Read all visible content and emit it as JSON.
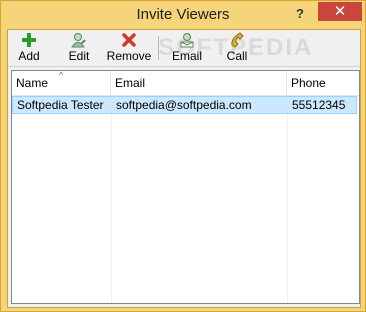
{
  "window": {
    "title": "Invite Viewers",
    "help": "?",
    "close": "✕"
  },
  "toolbar": {
    "add": "Add",
    "edit": "Edit",
    "remove": "Remove",
    "email": "Email",
    "call": "Call",
    "watermark": "SOFTPEDIA"
  },
  "columns": [
    "Name",
    "Email",
    "Phone"
  ],
  "sort_indicator": "^",
  "rows": [
    {
      "name": "Softpedia Tester",
      "email": "softpedia@softpedia.com",
      "phone": "55512345",
      "selected": true
    }
  ],
  "colors": {
    "frame": "#f6d57a",
    "close": "#c9463d",
    "selection": "#cce8ff"
  },
  "icons": {
    "add": "plus-icon",
    "edit": "edit-user-icon",
    "remove": "remove-icon",
    "email": "email-icon",
    "call": "phone-icon"
  }
}
